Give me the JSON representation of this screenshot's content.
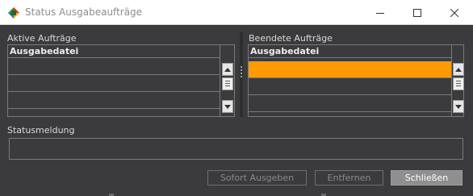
{
  "window": {
    "title": "Status Ausgabeaufträge"
  },
  "active_jobs": {
    "label": "Aktive Aufträge",
    "column_header": "Ausgabedatei",
    "rows": [
      "",
      "",
      ""
    ]
  },
  "finished_jobs": {
    "label": "Beendete Aufträge",
    "column_header": "Ausgabedatei",
    "rows": [
      "",
      "",
      ""
    ],
    "selected_row": 0,
    "selection_color": "#ff9a05"
  },
  "status": {
    "label": "Statusmeldung",
    "value": ""
  },
  "buttons": {
    "output_now": "Sofort Ausgeben",
    "remove": "Entfernen",
    "close": "Schließen"
  },
  "icons": {
    "app": "app-logo-icon",
    "minimize": "minimize-icon",
    "maximize": "maximize-icon",
    "close": "close-icon"
  }
}
